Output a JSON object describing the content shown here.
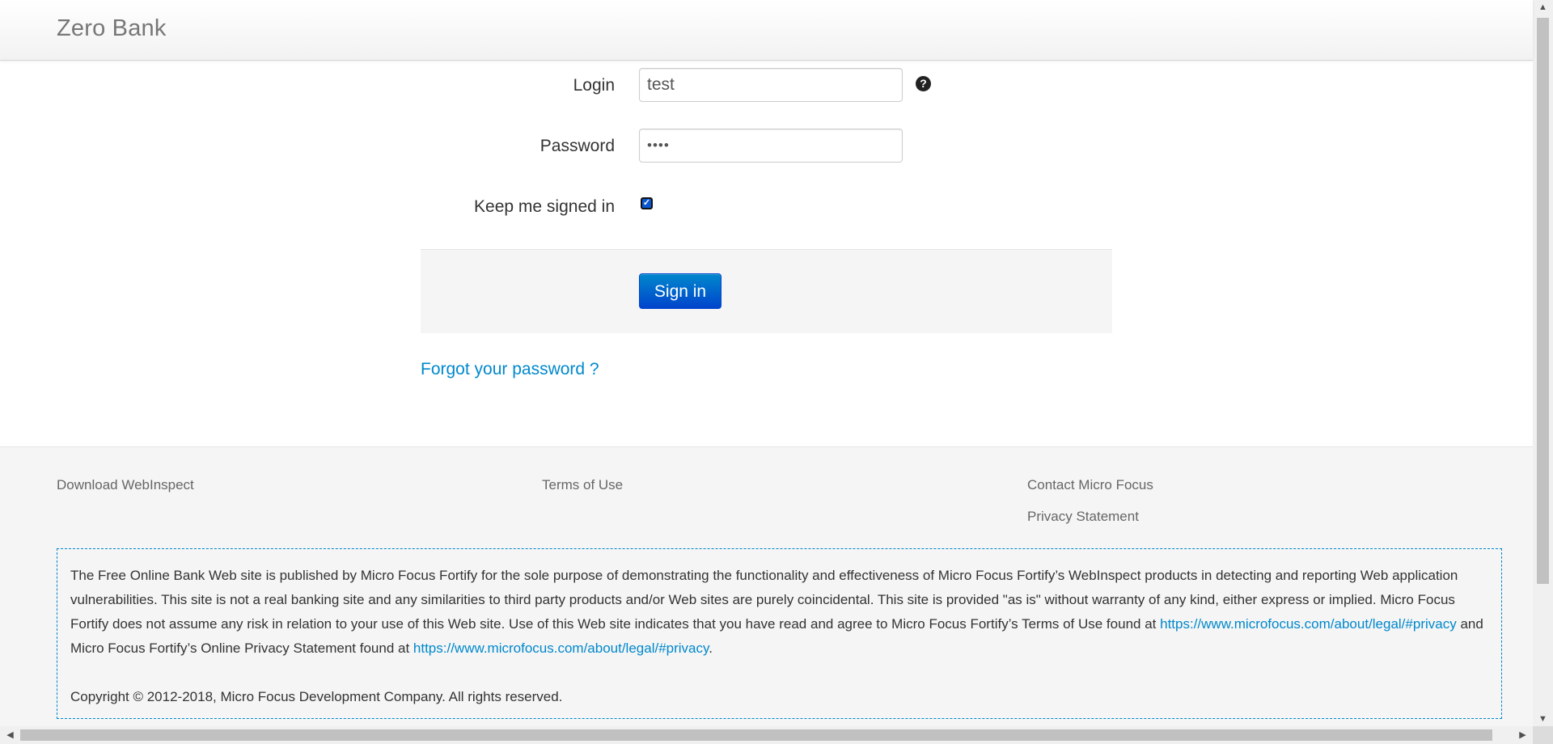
{
  "navbar": {
    "brand": "Zero Bank"
  },
  "login_form": {
    "login_label": "Login",
    "login_value": "test",
    "help_icon": "question-circle-icon",
    "password_label": "Password",
    "password_value": "••••",
    "remember_label": "Keep me signed in",
    "remember_checked": true,
    "submit_label": "Sign in",
    "forgot_link": "Forgot your password ?"
  },
  "footer": {
    "links": {
      "download": "Download WebInspect",
      "terms": "Terms of Use",
      "contact": "Contact Micro Focus",
      "privacy": "Privacy Statement"
    },
    "disclaimer": {
      "text_part1": "The Free Online Bank Web site is published by Micro Focus Fortify for the sole purpose of demonstrating the functionality and effectiveness of Micro Focus Fortify’s WebInspect products in detecting and reporting Web application vulnerabilities. This site is not a real banking site and any similarities to third party products and/or Web sites are purely coincidental. This site is provided \"as is\" without warranty of any kind, either express or implied. Micro Focus Fortify does not assume any risk in relation to your use of this Web site. Use of this Web site indicates that you have read and agree to Micro Focus Fortify’s Terms of Use found at ",
      "link1": "https://www.microfocus.com/about/legal/#privacy",
      "text_part2": " and Micro Focus Fortify’s Online Privacy Statement found at ",
      "link2": "https://www.microfocus.com/about/legal/#privacy",
      "text_part3": ".",
      "copyright": "Copyright © 2012-2018, Micro Focus Development Company. All rights reserved."
    }
  },
  "colors": {
    "link": "#0088cc",
    "primary_button": "#0044cc",
    "footer_bg": "#f5f5f5",
    "brand_text": "#777777"
  }
}
